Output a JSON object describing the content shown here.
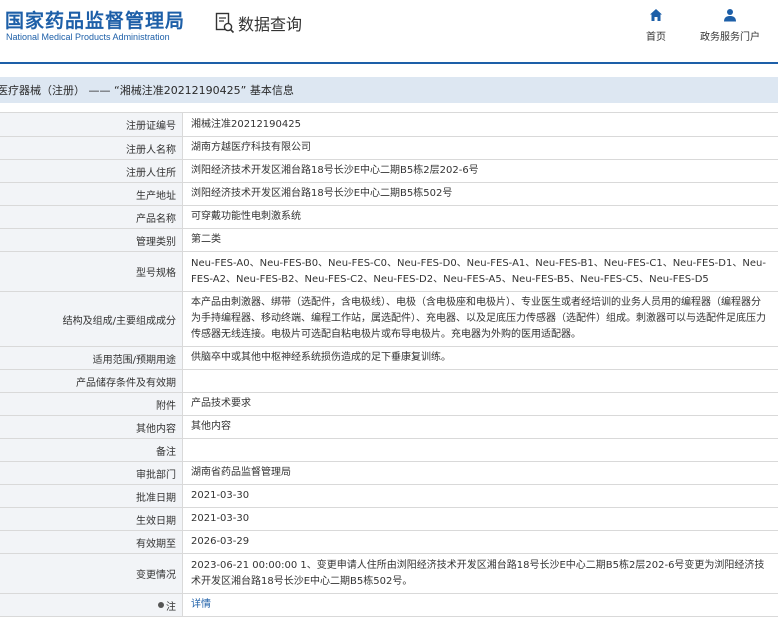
{
  "header": {
    "logo_cn": "国家药品监督管理局",
    "logo_en": "National Medical Products Administration",
    "query_label": "数据查询",
    "nav_home": "首页",
    "nav_portal": "政务服务门户"
  },
  "breadcrumb": "医疗器械（注册） —— “湘械注准20212190425” 基本信息",
  "colors": {
    "brand": "#1d5fa8",
    "label_bg": "#f2f4f7",
    "breadcrumb_bg": "#dde7f2"
  },
  "rows": [
    {
      "label": "注册证编号",
      "value": "湘械注准20212190425"
    },
    {
      "label": "注册人名称",
      "value": "湖南方越医疗科技有限公司"
    },
    {
      "label": "注册人住所",
      "value": "浏阳经济技术开发区湘台路18号长沙E中心二期B5栋2层202-6号"
    },
    {
      "label": "生产地址",
      "value": "浏阳经济技术开发区湘台路18号长沙E中心二期B5栋502号"
    },
    {
      "label": "产品名称",
      "value": "可穿戴功能性电刺激系统"
    },
    {
      "label": "管理类别",
      "value": "第二类"
    },
    {
      "label": "型号规格",
      "value": "Neu-FES-A0、Neu-FES-B0、Neu-FES-C0、Neu-FES-D0、Neu-FES-A1、Neu-FES-B1、Neu-FES-C1、Neu-FES-D1、Neu-FES-A2、Neu-FES-B2、Neu-FES-C2、Neu-FES-D2、Neu-FES-A5、Neu-FES-B5、Neu-FES-C5、Neu-FES-D5"
    },
    {
      "label": "结构及组成/主要组成成分",
      "value": "本产品由刺激器、绑带（选配件，含电极线）、电极（含电极座和电极片）、专业医生或者经培训的业务人员用的编程器（编程器分为手持编程器、移动终端、编程工作站，属选配件）、充电器、以及足底压力传感器（选配件）组成。刺激器可以与选配件足底压力传感器无线连接。电极片可选配自粘电极片或布导电极片。充电器为外购的医用适配器。"
    },
    {
      "label": "适用范围/预期用途",
      "value": "供脑卒中或其他中枢神经系统损伤造成的足下垂康复训练。"
    },
    {
      "label": "产品储存条件及有效期",
      "value": ""
    },
    {
      "label": "附件",
      "value": "产品技术要求"
    },
    {
      "label": "其他内容",
      "value": "其他内容"
    },
    {
      "label": "备注",
      "value": ""
    },
    {
      "label": "审批部门",
      "value": "湖南省药品监督管理局"
    },
    {
      "label": "批准日期",
      "value": "2021-03-30"
    },
    {
      "label": "生效日期",
      "value": "2021-03-30"
    },
    {
      "label": "有效期至",
      "value": "2026-03-29"
    },
    {
      "label": "变更情况",
      "value": "2023-06-21 00:00:00 1、变更申请人住所由浏阳经济技术开发区湘台路18号长沙E中心二期B5栋2层202-6号变更为浏阳经济技术开发区湘台路18号长沙E中心二期B5栋502号。"
    },
    {
      "label": "注",
      "value": "详情"
    }
  ]
}
